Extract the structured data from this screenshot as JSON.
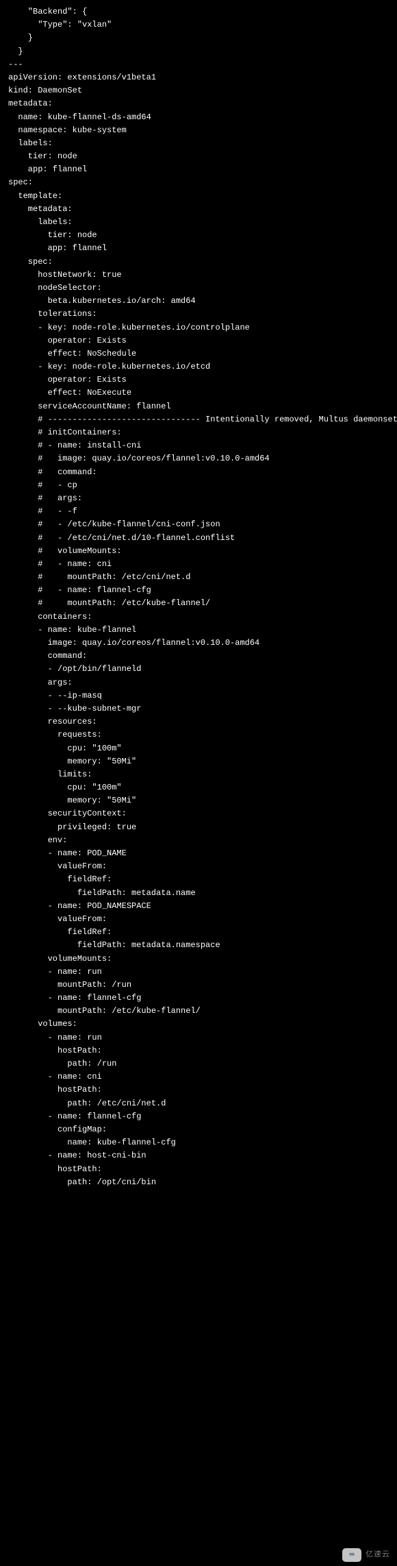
{
  "code": "    \"Backend\": {\n      \"Type\": \"vxlan\"\n    }\n  }\n---\napiVersion: extensions/v1beta1\nkind: DaemonSet\nmetadata:\n  name: kube-flannel-ds-amd64\n  namespace: kube-system\n  labels:\n    tier: node\n    app: flannel\nspec:\n  template:\n    metadata:\n      labels:\n        tier: node\n        app: flannel\n    spec:\n      hostNetwork: true\n      nodeSelector:\n        beta.kubernetes.io/arch: amd64\n      tolerations:\n      - key: node-role.kubernetes.io/controlplane\n        operator: Exists\n        effect: NoSchedule\n      - key: node-role.kubernetes.io/etcd\n        operator: Exists\n        effect: NoExecute\n      serviceAccountName: flannel\n      # ------------------------------- Intentionally removed, Multus daemonset configures /etc/cni/net.d\n      # initContainers:\n      # - name: install-cni\n      #   image: quay.io/coreos/flannel:v0.10.0-amd64\n      #   command:\n      #   - cp\n      #   args:\n      #   - -f\n      #   - /etc/kube-flannel/cni-conf.json\n      #   - /etc/cni/net.d/10-flannel.conflist\n      #   volumeMounts:\n      #   - name: cni\n      #     mountPath: /etc/cni/net.d\n      #   - name: flannel-cfg\n      #     mountPath: /etc/kube-flannel/\n      containers:\n      - name: kube-flannel\n        image: quay.io/coreos/flannel:v0.10.0-amd64\n        command:\n        - /opt/bin/flanneld\n        args:\n        - --ip-masq\n        - --kube-subnet-mgr\n        resources:\n          requests:\n            cpu: \"100m\"\n            memory: \"50Mi\"\n          limits:\n            cpu: \"100m\"\n            memory: \"50Mi\"\n        securityContext:\n          privileged: true\n        env:\n        - name: POD_NAME\n          valueFrom:\n            fieldRef:\n              fieldPath: metadata.name\n        - name: POD_NAMESPACE\n          valueFrom:\n            fieldRef:\n              fieldPath: metadata.namespace\n        volumeMounts:\n        - name: run\n          mountPath: /run\n        - name: flannel-cfg\n          mountPath: /etc/kube-flannel/\n      volumes:\n        - name: run\n          hostPath:\n            path: /run\n        - name: cni\n          hostPath:\n            path: /etc/cni/net.d\n        - name: flannel-cfg\n          configMap:\n            name: kube-flannel-cfg\n        - name: host-cni-bin\n          hostPath:\n            path: /opt/cni/bin",
  "watermark": {
    "icon_text": "∞",
    "label": "亿速云"
  }
}
